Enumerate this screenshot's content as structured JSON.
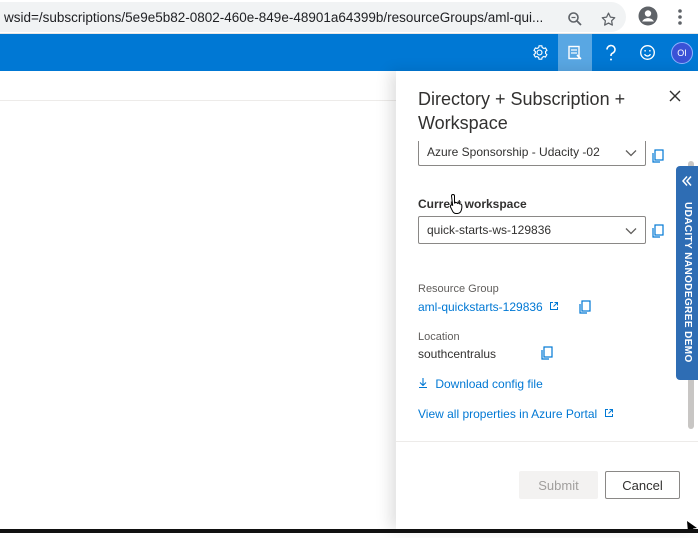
{
  "browser": {
    "url": "wsid=/subscriptions/5e9e5b82-0802-460e-849e-48901a64399b/resourceGroups/aml-qui...",
    "icons": [
      "zoom-icon",
      "star-icon",
      "profile-icon",
      "more-vert-icon"
    ]
  },
  "header": {
    "icons": [
      "gear-icon",
      "feedback-notes-icon",
      "help-icon",
      "smiley-icon"
    ],
    "avatar_initials": "OI"
  },
  "panel": {
    "title": "Directory + Subscription + Workspace",
    "subscription_value": "Azure Sponsorship - Udacity -02",
    "workspace_label": "Current workspace",
    "workspace_value": "quick-starts-ws-129836",
    "resource_group_label": "Resource Group",
    "resource_group_value": "aml-quickstarts-129836",
    "location_label": "Location",
    "location_value": "southcentralus",
    "download_label": "Download config file",
    "view_all_label": "View all properties in Azure Portal",
    "submit_label": "Submit",
    "cancel_label": "Cancel"
  },
  "side_tab": {
    "label": "UDACITY NANODEGREE DEMO"
  },
  "colors": {
    "azure_blue": "#0078d4",
    "link": "#0078d4",
    "udacity_tab": "#2e6db4"
  }
}
